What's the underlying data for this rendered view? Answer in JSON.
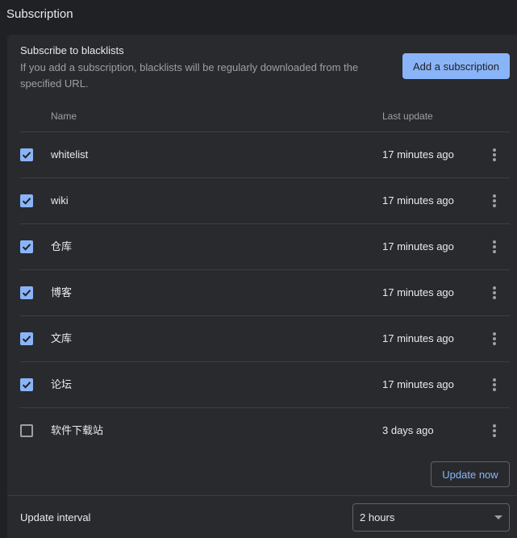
{
  "page": {
    "title": "Subscription"
  },
  "section": {
    "title": "Subscribe to blacklists",
    "description": "If you add a subscription, blacklists will be regularly downloaded from the specified URL.",
    "add_button": "Add a subscription"
  },
  "table": {
    "headers": {
      "name": "Name",
      "last_update": "Last update"
    },
    "rows": [
      {
        "name": "whitelist",
        "last_update": "17 minutes ago",
        "checked": true
      },
      {
        "name": "wiki",
        "last_update": "17 minutes ago",
        "checked": true
      },
      {
        "name": "仓库",
        "last_update": "17 minutes ago",
        "checked": true
      },
      {
        "name": "博客",
        "last_update": "17 minutes ago",
        "checked": true
      },
      {
        "name": "文库",
        "last_update": "17 minutes ago",
        "checked": true
      },
      {
        "name": "论坛",
        "last_update": "17 minutes ago",
        "checked": true
      },
      {
        "name": "软件下载站",
        "last_update": "3 days ago",
        "checked": false
      }
    ]
  },
  "actions": {
    "update_now": "Update now"
  },
  "interval": {
    "label": "Update interval",
    "value": "2 hours"
  },
  "icons": {
    "checkbox": "check-icon",
    "row_menu": "more-vert-icon",
    "select": "caret-down-icon"
  },
  "colors": {
    "accent": "#8ab4f8",
    "background": "#202124",
    "card": "#292a2d",
    "divider": "#3c4043"
  }
}
